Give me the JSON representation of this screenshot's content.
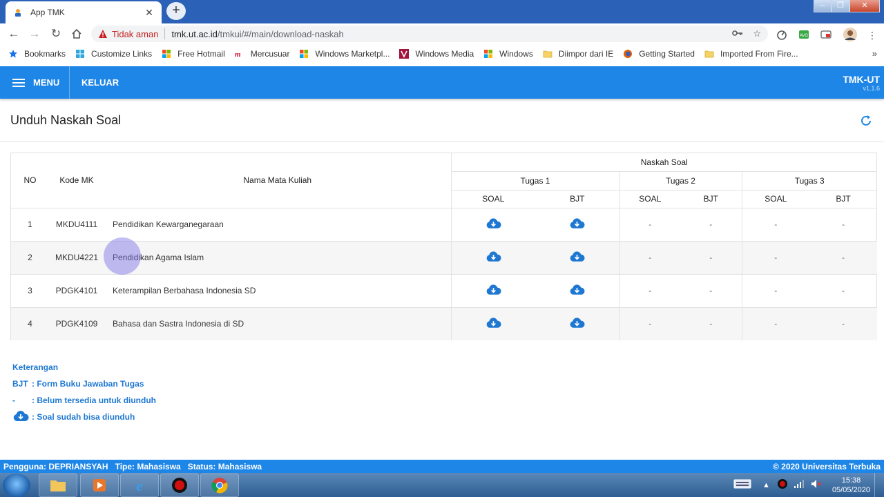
{
  "browser": {
    "tab_title": "App TMK",
    "tab_close": "✕",
    "new_tab": "+",
    "security_label": "Tidak aman",
    "url_host": "tmk.ut.ac.id",
    "url_path": "/tmkui/#/main/download-naskah",
    "bookmarks": [
      {
        "label": "Bookmarks",
        "icon": "star-icon"
      },
      {
        "label": "Customize Links",
        "icon": "windows-icon"
      },
      {
        "label": "Free Hotmail",
        "icon": "windows-icon"
      },
      {
        "label": "Mercusuar",
        "icon": "mercusuar-icon"
      },
      {
        "label": "Windows Marketpl...",
        "icon": "windows-icon"
      },
      {
        "label": "Windows Media",
        "icon": "media-icon"
      },
      {
        "label": "Windows",
        "icon": "windows-icon"
      },
      {
        "label": "Diimpor dari IE",
        "icon": "folder-icon"
      },
      {
        "label": "Getting Started",
        "icon": "firefox-icon"
      },
      {
        "label": "Imported From Fire...",
        "icon": "folder-icon"
      }
    ],
    "bookmarks_more": "»"
  },
  "appbar": {
    "menu_label": "MENU",
    "logout_label": "KELUAR",
    "brand": "TMK-UT",
    "version": "v1.1.6"
  },
  "page": {
    "title": "Unduh Naskah Soal"
  },
  "table": {
    "headers": {
      "no": "NO",
      "kode": "Kode MK",
      "nama": "Nama Mata Kuliah",
      "naskah": "Naskah Soal",
      "tugas1": "Tugas 1",
      "tugas2": "Tugas 2",
      "tugas3": "Tugas 3",
      "soal": "SOAL",
      "bjt": "BJT"
    },
    "rows": [
      {
        "no": "1",
        "kode": "MKDU4111",
        "nama": "Pendidikan Kewarganegaraan",
        "t1_soal": "download",
        "t1_bjt": "download",
        "t2_soal": "-",
        "t2_bjt": "-",
        "t3_soal": "-",
        "t3_bjt": "-"
      },
      {
        "no": "2",
        "kode": "MKDU4221",
        "nama": "Pendidikan Agama Islam",
        "t1_soal": "download",
        "t1_bjt": "download",
        "t2_soal": "-",
        "t2_bjt": "-",
        "t3_soal": "-",
        "t3_bjt": "-"
      },
      {
        "no": "3",
        "kode": "PDGK4101",
        "nama": "Keterampilan Berbahasa Indonesia SD",
        "t1_soal": "download",
        "t1_bjt": "download",
        "t2_soal": "-",
        "t2_bjt": "-",
        "t3_soal": "-",
        "t3_bjt": "-"
      },
      {
        "no": "4",
        "kode": "PDGK4109",
        "nama": "Bahasa dan Sastra Indonesia di SD",
        "t1_soal": "download",
        "t1_bjt": "download",
        "t2_soal": "-",
        "t2_bjt": "-",
        "t3_soal": "-",
        "t3_bjt": "-"
      }
    ]
  },
  "legend": {
    "title": "Keterangan",
    "bjt_key": "BJT",
    "bjt_desc": ": Form Buku Jawaban Tugas",
    "dash_key": "-",
    "dash_desc": ": Belum tersedia untuk diunduh",
    "dl_desc": ": Soal sudah bisa diunduh"
  },
  "status": {
    "user": "Pengguna: DEPRIANSYAH",
    "type": "Tipe: Mahasiswa",
    "state": "Status: Mahasiswa",
    "copyright": "© 2020 Universitas Terbuka"
  },
  "taskbar": {
    "time": "15:38",
    "date": "05/05/2020"
  },
  "colors": {
    "primary": "#1e86e6",
    "link": "#1e78d2",
    "insecure": "#c5221f"
  }
}
